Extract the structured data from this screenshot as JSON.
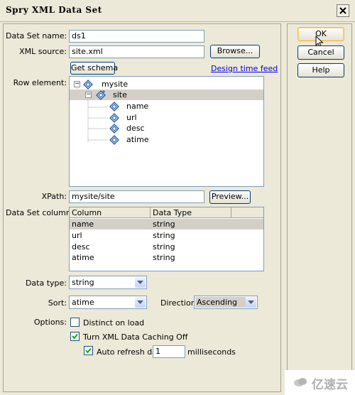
{
  "window": {
    "title": "Spry XML Data Set"
  },
  "form": {
    "dataset_name_label": "Data Set name:",
    "dataset_name_value": "ds1",
    "xml_source_label": "XML source:",
    "xml_source_value": "site.xml",
    "browse_label": "Browse...",
    "get_schema_label": "Get schema",
    "design_time_feed_label": "Design time feed",
    "row_element_label": "Row element:",
    "tree": [
      {
        "label": "mysite",
        "level": 0,
        "expander": "minus",
        "selected": false
      },
      {
        "label": "site",
        "level": 1,
        "expander": "minus",
        "selected": true
      },
      {
        "label": "name",
        "level": 2,
        "expander": "",
        "selected": false
      },
      {
        "label": "url",
        "level": 2,
        "expander": "",
        "selected": false
      },
      {
        "label": "desc",
        "level": 2,
        "expander": "",
        "selected": false
      },
      {
        "label": "atime",
        "level": 2,
        "expander": "",
        "selected": false
      }
    ],
    "xpath_label": "XPath:",
    "xpath_value": "mysite/site",
    "preview_label": "Preview...",
    "columns_label": "Data Set columns:",
    "columns_headers": [
      "Column",
      "Data Type"
    ],
    "columns_rows": [
      [
        "name",
        "string"
      ],
      [
        "url",
        "string"
      ],
      [
        "desc",
        "string"
      ],
      [
        "atime",
        "string"
      ]
    ],
    "data_type_label": "Data type:",
    "data_type_value": "string",
    "sort_label": "Sort:",
    "sort_value": "atime",
    "direction_label": "Direction:",
    "direction_value": "Ascending",
    "options_label": "Options:",
    "distinct_label": "Distinct on load",
    "distinct_checked": false,
    "caching_label": "Turn XML Data Caching Off",
    "caching_checked": true,
    "autorefresh_label": "Auto refresh data",
    "autorefresh_checked": true,
    "autorefresh_value": "1",
    "autorefresh_unit": "milliseconds"
  },
  "side": {
    "ok_label": "OK",
    "cancel_label": "Cancel",
    "help_label": "Help"
  },
  "watermark": {
    "text": "亿速云"
  },
  "colors": {
    "input_border": "#7f9db9",
    "dialog_bg": "#ece9d8",
    "link": "#0000ee",
    "selected_row": "#d4d0c8"
  }
}
